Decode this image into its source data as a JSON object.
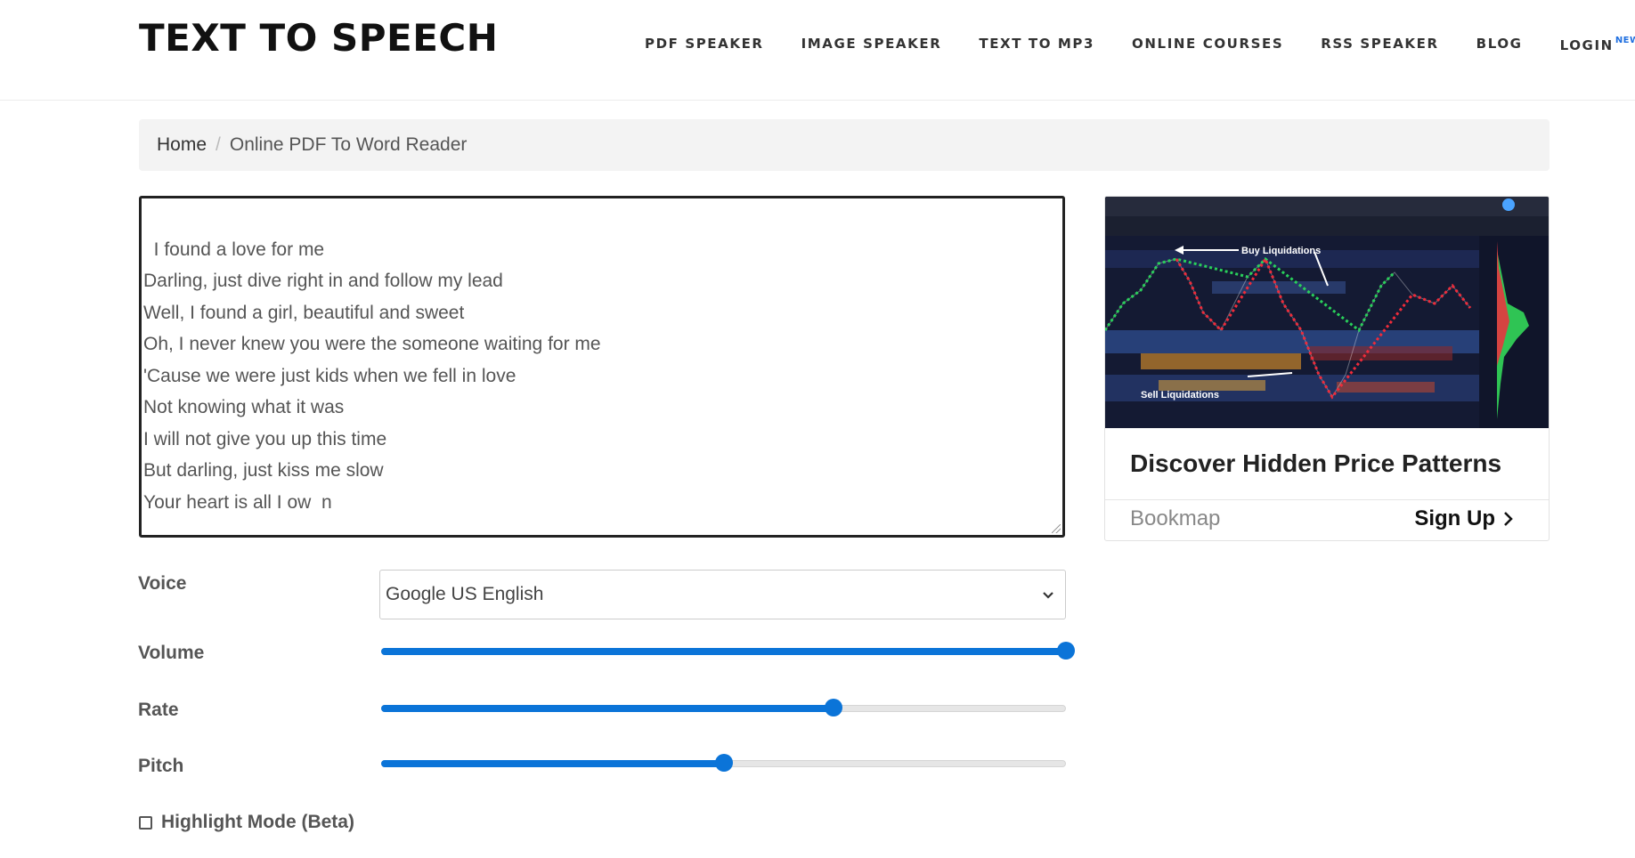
{
  "header": {
    "logo": "TEXT TO SPEECH",
    "nav": [
      {
        "label": "PDF SPEAKER"
      },
      {
        "label": "IMAGE SPEAKER"
      },
      {
        "label": "TEXT TO MP3"
      },
      {
        "label": "ONLINE COURSES"
      },
      {
        "label": "RSS SPEAKER"
      },
      {
        "label": "BLOG"
      },
      {
        "label": "LOGIN",
        "badge": "NEW!"
      }
    ]
  },
  "breadcrumb": {
    "home": "Home",
    "separator": "/",
    "current": "Online PDF To Word Reader"
  },
  "editor": {
    "text": "I found a love for me\nDarling, just dive right in and follow my lead\nWell, I found a girl, beautiful and sweet\nOh, I never knew you were the someone waiting for me\n'Cause we were just kids when we fell in love\nNot knowing what it was\nI will not give you up this time\nBut darling, just kiss me slow\nYour heart is all I ow  n"
  },
  "controls": {
    "voice_label": "Voice",
    "voice_value": "Google US English",
    "volume_label": "Volume",
    "volume_level": 1.0,
    "rate_label": "Rate",
    "rate_level": 0.66,
    "pitch_label": "Pitch",
    "pitch_level": 0.5,
    "highlight_label": "Highlight Mode (Beta)",
    "highlight_checked": false,
    "accent_color": "#0b74d8"
  },
  "ad": {
    "chart_annotations": [
      "Buy Liquidations",
      "Sell Liquidations"
    ],
    "title": "Discover Hidden Price Patterns",
    "brand": "Bookmap",
    "cta": "Sign Up"
  }
}
